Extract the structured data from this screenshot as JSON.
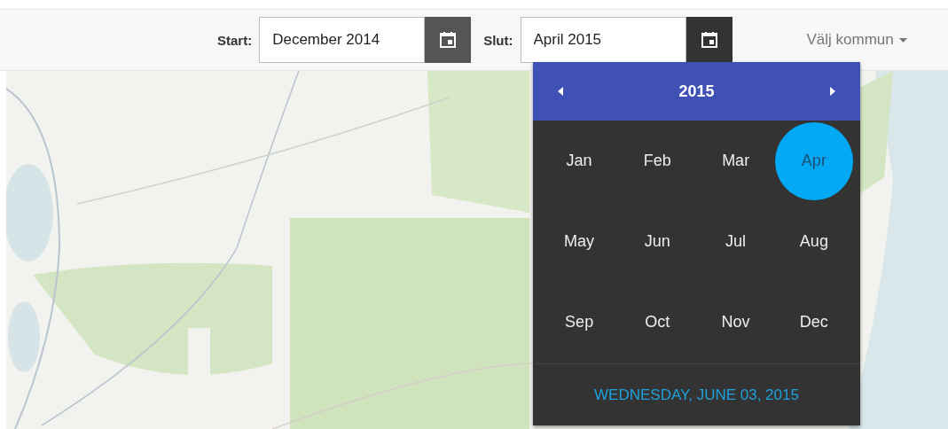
{
  "toolbar": {
    "fields": [
      {
        "label": "Start:",
        "value": "December 2014",
        "open": false
      },
      {
        "label": "Slut:",
        "value": "April 2015",
        "open": true
      }
    ],
    "municipality": {
      "label": "Välj kommun"
    }
  },
  "picker": {
    "year": "2015",
    "months": [
      {
        "label": "Jan",
        "selected": false
      },
      {
        "label": "Feb",
        "selected": false
      },
      {
        "label": "Mar",
        "selected": false
      },
      {
        "label": "Apr",
        "selected": true
      },
      {
        "label": "May",
        "selected": false
      },
      {
        "label": "Jun",
        "selected": false
      },
      {
        "label": "Jul",
        "selected": false
      },
      {
        "label": "Aug",
        "selected": false
      },
      {
        "label": "Sep",
        "selected": false
      },
      {
        "label": "Oct",
        "selected": false
      },
      {
        "label": "Nov",
        "selected": false
      },
      {
        "label": "Dec",
        "selected": false
      }
    ],
    "footer": "WEDNESDAY, JUNE 03, 2015"
  }
}
